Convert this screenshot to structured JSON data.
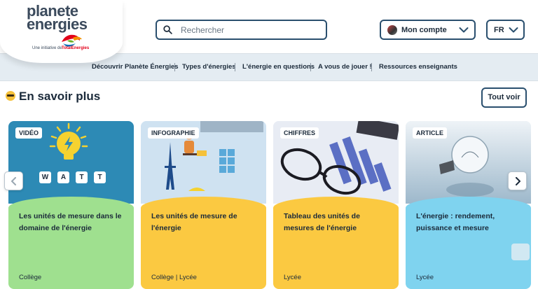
{
  "header": {
    "logo_line1": "planete",
    "logo_line2": "energies",
    "logo_initiative": "Une initiative de",
    "logo_brand": "TotalEnergies",
    "search_placeholder": "Rechercher",
    "account_label": "Mon compte",
    "language": "FR"
  },
  "nav": {
    "items": [
      "Découvrir Planète Énergies",
      "Types d'énergies",
      "L'énergie en questions",
      "A vous de jouer !",
      "Ressources enseignants"
    ]
  },
  "section": {
    "title": "En savoir plus",
    "see_all": "Tout voir"
  },
  "cards": [
    {
      "type": "VIDÉO",
      "title": "Les unités de mesure dans le domaine de l'énergie",
      "level": "Collège",
      "color": "#9fe08f",
      "image": "watt-bulb-illustration"
    },
    {
      "type": "INFOGRAPHIE",
      "title": "Les unités de mesure de l'énergie",
      "level": "Collège | Lycée",
      "color": "#fbc941",
      "image": "eiffel-tower-infographic"
    },
    {
      "type": "CHIFFRES",
      "title": "Tableau des unités de mesures de l'énergie",
      "level": "Lycée",
      "color": "#fbc941",
      "image": "glasses-on-charts-photo"
    },
    {
      "type": "ARTICLE",
      "title": "L'énergie : rendement, puissance et mesure",
      "level": "Lycée",
      "color": "#7fd3ef",
      "image": "light-bulb-photo"
    }
  ],
  "watt_letters": [
    "W",
    "A",
    "T",
    "T"
  ],
  "colors": {
    "accent_border": "#2a4f6e",
    "nav_background": "#e4ecf2",
    "text": "#1b2a3a"
  }
}
